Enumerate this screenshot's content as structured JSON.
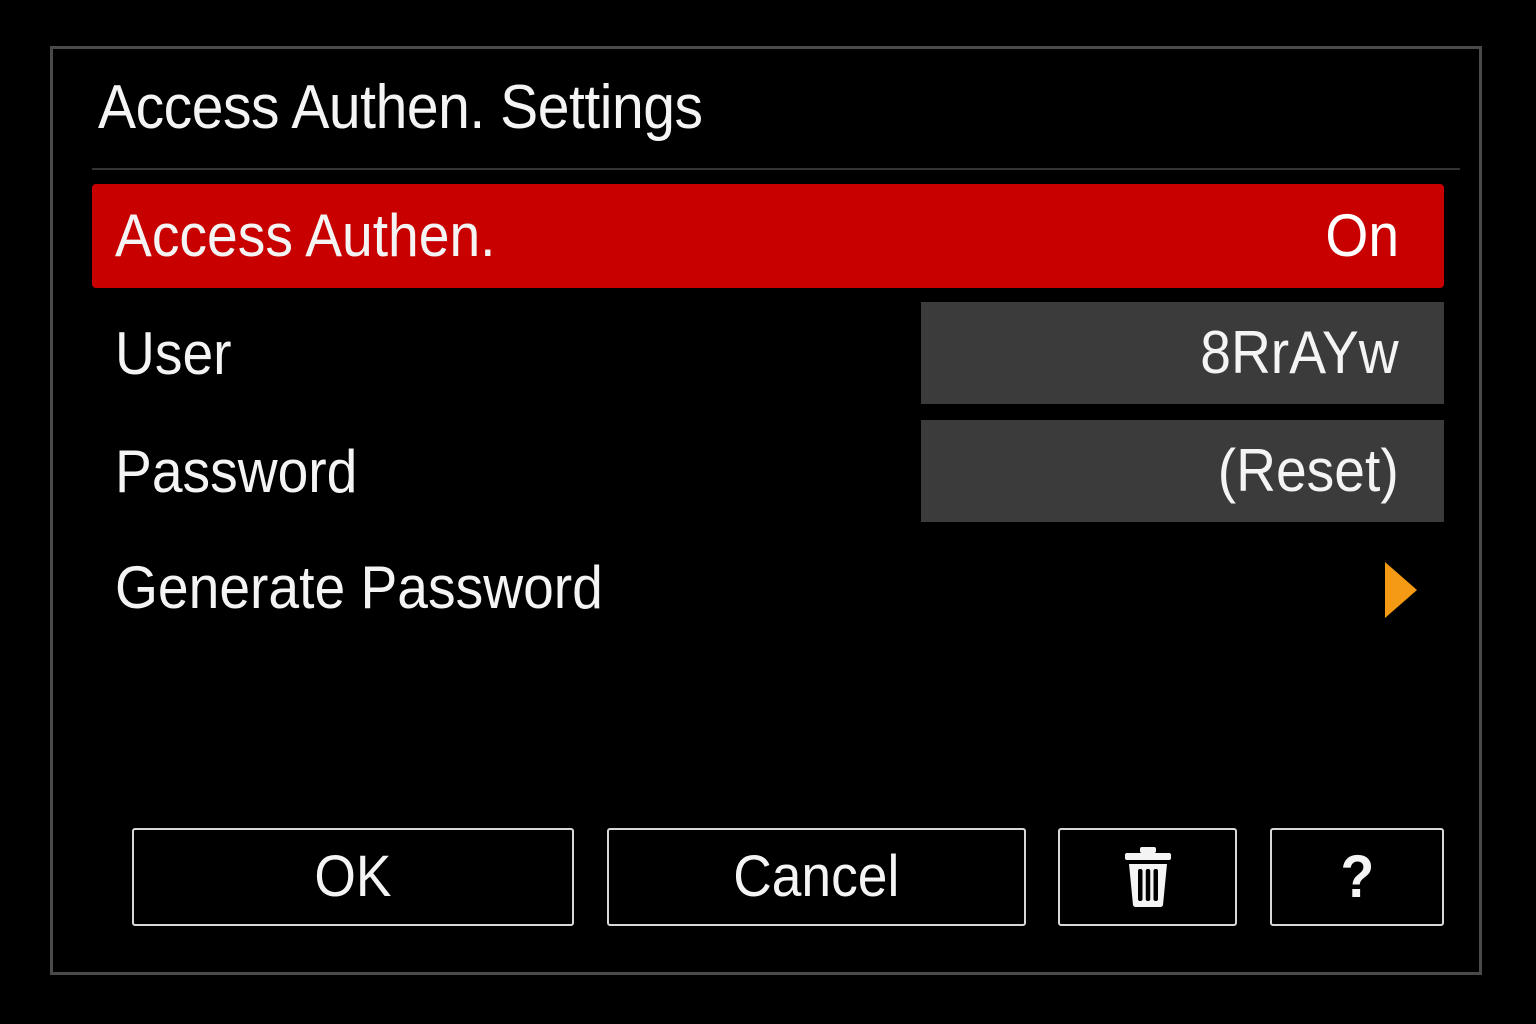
{
  "screen": {
    "title": "Access Authen. Settings"
  },
  "settings": {
    "access_authen": {
      "label": "Access Authen.",
      "value": "On"
    },
    "user": {
      "label": "User",
      "value": "8RrAYw"
    },
    "password": {
      "label": "Password",
      "value": "(Reset)"
    },
    "generate_password": {
      "label": "Generate Password",
      "icon": "chevron-right-icon"
    }
  },
  "buttons": {
    "ok": "OK",
    "cancel": "Cancel",
    "delete_icon": "trash-icon",
    "help": "?"
  },
  "colors": {
    "background": "#000000",
    "highlight": "#c80000",
    "value_box": "#3b3b3b",
    "arrow_accent": "#f59a14",
    "text": "#f4f4f4"
  }
}
